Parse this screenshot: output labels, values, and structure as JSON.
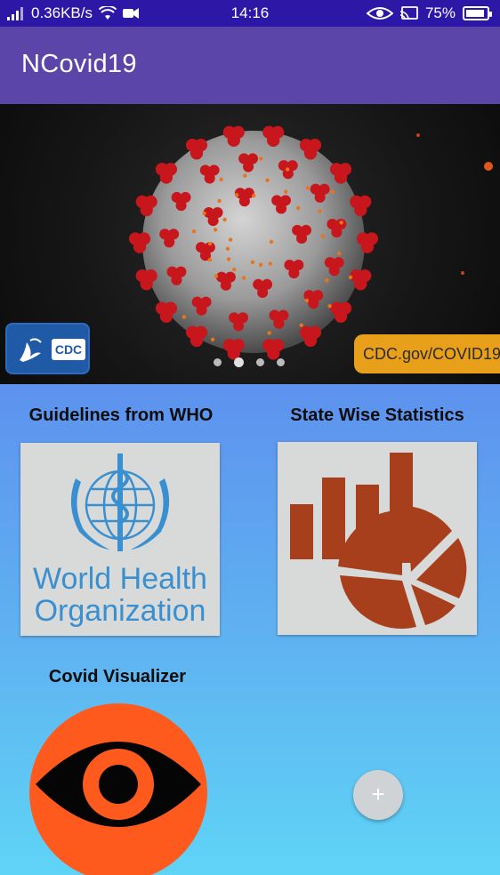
{
  "status_bar": {
    "network_speed": "0.36KB/s",
    "time": "14:16",
    "battery_percent": "75%",
    "battery_level": 0.75
  },
  "app_bar": {
    "title": "NCovid19"
  },
  "banner": {
    "cdc_mark": "CDC",
    "url_label": "CDC.gov/COVID19",
    "pages": 4,
    "active_page": 2
  },
  "cards": [
    {
      "label": "Guidelines from WHO",
      "logo_line1": "World Health",
      "logo_line2": "Organization"
    },
    {
      "label": "State Wise Statistics"
    },
    {
      "label": "Covid Visualizer"
    }
  ],
  "fab": {
    "icon": "+"
  },
  "colors": {
    "status_bar": "#2d17a6",
    "app_bar": "#5c45a8",
    "who_blue": "#3a8fd0",
    "stats_brown": "#a83f1c",
    "visualizer_orange": "#ff5a1e"
  }
}
